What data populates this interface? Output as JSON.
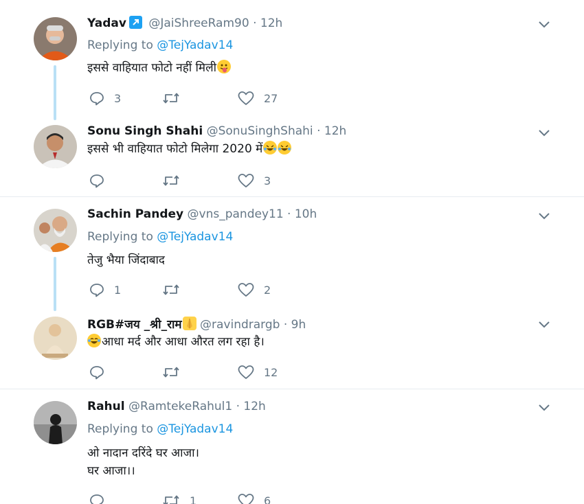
{
  "tweets": [
    {
      "name": "Yadav",
      "verified_badge": true,
      "handle": "@JaiShreeRam90",
      "time": "12h",
      "replying_prefix": "Replying to",
      "replying_to": "@TejYadav14",
      "text": "इससे वाहियात फोटो नहीं मिली",
      "emoji": "tongue-face",
      "replies": "3",
      "retweets": "",
      "likes": "27"
    },
    {
      "name": "Sonu Singh Shahi",
      "handle": "@SonuSinghShahi",
      "time": "12h",
      "text": "इससे भी वाहियात फोटो मिलेगा 2020 में",
      "emoji": "rofl x2",
      "replies": "",
      "retweets": "",
      "likes": "3"
    },
    {
      "name": "Sachin Pandey",
      "handle": "@vns_pandey11",
      "time": "10h",
      "replying_prefix": "Replying to",
      "replying_to": "@TejYadav14",
      "text": "तेजु भैया जिंदाबाद",
      "replies": "1",
      "retweets": "",
      "likes": "2"
    },
    {
      "name": "RGB#जय _श्री_राम",
      "name_emoji": "folded-hands",
      "handle": "@ravindrargb",
      "time": "9h",
      "text": "आधा मर्द और आधा औरत लग रहा है।",
      "emoji": "laughing-tears",
      "replies": "",
      "retweets": "",
      "likes": "12"
    },
    {
      "name": "Rahul",
      "handle": "@RamtekeRahul1",
      "time": "12h",
      "replying_prefix": "Replying to",
      "replying_to": "@TejYadav14",
      "text_line1": "ओ नादान दरिंदे घर आजा।",
      "text_line2": "घर आजा।।",
      "replies": "",
      "retweets": "1",
      "likes": "6"
    }
  ],
  "separator": "·",
  "colors": {
    "link": "#1b95e0",
    "muted": "#657786",
    "thread_line": "#b9e0f5",
    "divider": "#e6ecf0",
    "verified": "#1da1f2"
  }
}
